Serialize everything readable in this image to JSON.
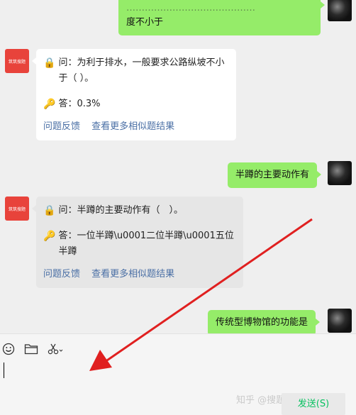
{
  "messages": {
    "m0_right": "度不小于",
    "m1": {
      "avatar_text": "筑筑搜题",
      "question": "问：为利于排水，一般要求公路纵坡不小于（ ）。",
      "answer": "答：0.3%",
      "link_feedback": "问题反馈",
      "link_more": "查看更多相似题结果"
    },
    "m2_right": "半蹲的主要动作有",
    "m3": {
      "avatar_text": "筑筑搜题",
      "question": "问：半蹲的主要动作有（　）。",
      "answer": "答：一位半蹲\\u0001二位半蹲\\u0001五位半蹲",
      "link_feedback": "问题反馈",
      "link_more": "查看更多相似题结果"
    },
    "m4_right": "传统型博物馆的功能是"
  },
  "toolbar": {
    "emoji_icon": "emoji-icon",
    "folder_icon": "folder-icon",
    "scissors_icon": "scissors-icon"
  },
  "send_label": "发送(S)",
  "watermark": "知乎 @搜题公众号搭建",
  "colors": {
    "right_bubble": "#95ec69",
    "bot_avatar": "#e8433b",
    "arrow": "#e02020",
    "link": "#4a6fa5"
  }
}
